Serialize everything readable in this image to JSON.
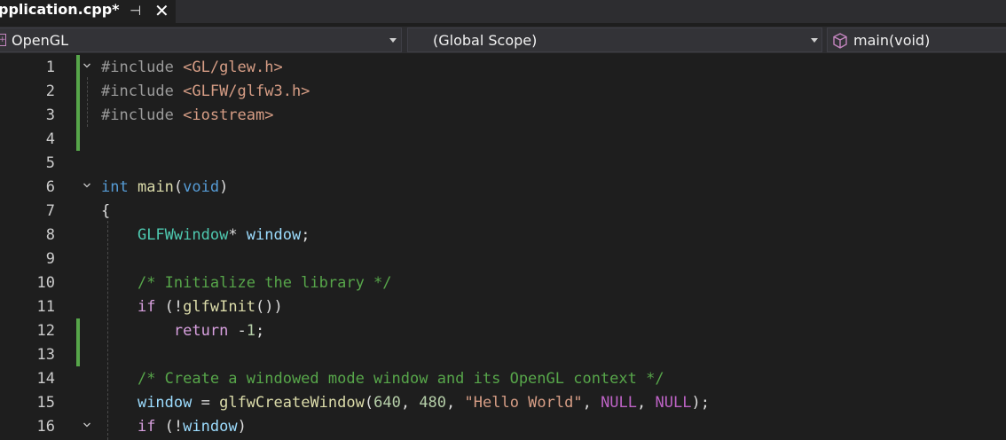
{
  "tab": {
    "title": "pplication.cpp*",
    "pin_glyph": "⊣",
    "close_glyph": "✕"
  },
  "navbar": {
    "project": "OpenGL",
    "scope": "(Global Scope)",
    "member": "main(void)"
  },
  "colors": {
    "background": "#1e1e1e",
    "change_bar": "#57a64a",
    "keyword": "#569cd6",
    "string": "#d69d85",
    "comment": "#57a64a",
    "type": "#4ec9b0",
    "function": "#dcdcaa",
    "variable": "#9cdcfe",
    "control": "#d8a0df",
    "macro": "#bd63c5",
    "number": "#b5cea8"
  },
  "lines": [
    {
      "n": "1",
      "tokens": [
        [
          "pp",
          "#include "
        ],
        [
          "str",
          "<GL/glew.h>"
        ]
      ]
    },
    {
      "n": "2",
      "tokens": [
        [
          "pp",
          "#include "
        ],
        [
          "str",
          "<GLFW/glfw3.h>"
        ]
      ]
    },
    {
      "n": "3",
      "tokens": [
        [
          "pp",
          "#include "
        ],
        [
          "str",
          "<iostream>"
        ]
      ]
    },
    {
      "n": "4",
      "tokens": []
    },
    {
      "n": "5",
      "tokens": []
    },
    {
      "n": "6",
      "tokens": [
        [
          "kw",
          "int"
        ],
        [
          "pl",
          " "
        ],
        [
          "fn",
          "main"
        ],
        [
          "pl",
          "("
        ],
        [
          "kw",
          "void"
        ],
        [
          "pl",
          ")"
        ]
      ]
    },
    {
      "n": "7",
      "tokens": [
        [
          "pl",
          "{"
        ]
      ]
    },
    {
      "n": "8",
      "tokens": [
        [
          "pl",
          "    "
        ],
        [
          "ty",
          "GLFWwindow"
        ],
        [
          "pl",
          "* "
        ],
        [
          "var",
          "window"
        ],
        [
          "pl",
          ";"
        ]
      ]
    },
    {
      "n": "9",
      "tokens": []
    },
    {
      "n": "10",
      "tokens": [
        [
          "pl",
          "    "
        ],
        [
          "cm",
          "/* Initialize the library */"
        ]
      ]
    },
    {
      "n": "11",
      "tokens": [
        [
          "pl",
          "    "
        ],
        [
          "ctl",
          "if"
        ],
        [
          "pl",
          " (!"
        ],
        [
          "fn",
          "glfwInit"
        ],
        [
          "pl",
          "())"
        ]
      ]
    },
    {
      "n": "12",
      "tokens": [
        [
          "pl",
          "        "
        ],
        [
          "ctl",
          "return"
        ],
        [
          "pl",
          " -"
        ],
        [
          "num",
          "1"
        ],
        [
          "pl",
          ";"
        ]
      ]
    },
    {
      "n": "13",
      "tokens": []
    },
    {
      "n": "14",
      "tokens": [
        [
          "pl",
          "    "
        ],
        [
          "cm",
          "/* Create a windowed mode window and its OpenGL context */"
        ]
      ]
    },
    {
      "n": "15",
      "tokens": [
        [
          "pl",
          "    "
        ],
        [
          "var",
          "window"
        ],
        [
          "pl",
          " = "
        ],
        [
          "fn",
          "glfwCreateWindow"
        ],
        [
          "pl",
          "("
        ],
        [
          "num",
          "640"
        ],
        [
          "pl",
          ", "
        ],
        [
          "num",
          "480"
        ],
        [
          "pl",
          ", "
        ],
        [
          "str",
          "\"Hello World\""
        ],
        [
          "pl",
          ", "
        ],
        [
          "mac",
          "NULL"
        ],
        [
          "pl",
          ", "
        ],
        [
          "mac",
          "NULL"
        ],
        [
          "pl",
          ");"
        ]
      ]
    },
    {
      "n": "16",
      "tokens": [
        [
          "pl",
          "    "
        ],
        [
          "ctl",
          "if"
        ],
        [
          "pl",
          " (!"
        ],
        [
          "var",
          "window"
        ],
        [
          "pl",
          ")"
        ]
      ]
    }
  ],
  "folds": [
    "1",
    "6",
    "16"
  ],
  "changed": [
    [
      "1",
      "4"
    ],
    [
      "12",
      "13"
    ]
  ]
}
